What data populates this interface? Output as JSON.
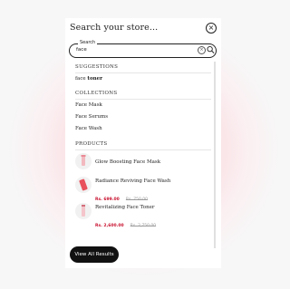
{
  "modal": {
    "title": "Search your store..."
  },
  "search": {
    "label": "Search",
    "value": "face"
  },
  "suggestions": {
    "heading": "SUGGESTIONS",
    "items": [
      {
        "prefix": "face",
        "suffix": "toner"
      }
    ]
  },
  "collections": {
    "heading": "COLLECTIONS",
    "items": [
      "Face Mask",
      "Face Serums",
      "Face Wash"
    ]
  },
  "products": {
    "heading": "PRODUCTS",
    "items": [
      {
        "name": "Glow Boosting Face Mask",
        "price": "",
        "old_price": ""
      },
      {
        "name": "Radiance Reviving Face Wash",
        "price": "Rs. 699.00",
        "old_price": "Rs. 750.00"
      },
      {
        "name": "Revitalizing Face Toner",
        "price": "Rs. 2,600.00",
        "old_price": "Rs. 2,750.00"
      }
    ]
  },
  "footer": {
    "view_all_label": "View All Results"
  },
  "colors": {
    "accent": "#c8102e",
    "button_bg": "#111111"
  }
}
